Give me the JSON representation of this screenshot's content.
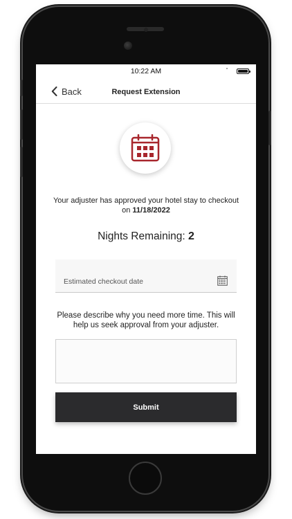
{
  "status_bar": {
    "time": "10:22 AM"
  },
  "nav": {
    "back_label": "Back",
    "title": "Request Extension"
  },
  "approval": {
    "message": "Your adjuster has approved your hotel stay to checkout on ",
    "checkout_date": "11/18/2022"
  },
  "nights": {
    "label": "Nights Remaining: ",
    "count": "2"
  },
  "checkout_field": {
    "placeholder": "Estimated checkout date"
  },
  "describe_prompt": "Please describe why you need more time. This will help us seek approval from your adjuster.",
  "reason_box": {
    "value": ""
  },
  "submit_label": "Submit",
  "colors": {
    "accent": "#a8262c",
    "button": "#2b2b2d"
  },
  "icons": {
    "header": "calendar-icon",
    "field": "calendar-grid-icon",
    "back": "chevron-left-icon"
  }
}
